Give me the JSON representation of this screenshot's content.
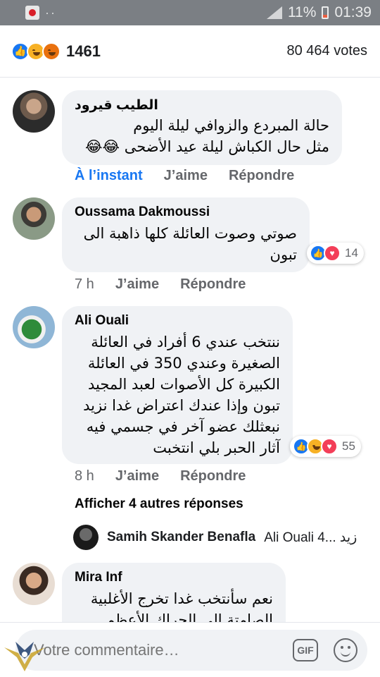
{
  "statusbar": {
    "battery": "11%",
    "time": "01:39"
  },
  "header": {
    "reaction_count": "1461",
    "votes": "80 464 votes"
  },
  "comments": [
    {
      "author": "الطيب قيرود",
      "lines": [
        "حالة المبردع والزوافي ليلة اليوم",
        "مثل حال الكباش ليلة عيد الأضحى 😂😂"
      ],
      "time": "À l’instant",
      "like": "J’aime",
      "reply": "Répondre"
    },
    {
      "author": "Oussama Dakmoussi",
      "lines": [
        "صوتي وصوت العائلة كلها ذاهبة الى",
        "تبون"
      ],
      "time": "7 h",
      "like": "J’aime",
      "reply": "Répondre",
      "reactions_count": "14"
    },
    {
      "author": "Ali Ouali",
      "lines": [
        "ننتخب عندي 6 أفراد في العائلة",
        "الصغيرة وعندي 350 في العائلة",
        "الكبيرة كل الأصوات لعبد المجيد",
        "تبون وإذا عندك اعتراض غدا نزيد",
        "نبعثلك عضو آخر في جسمي فيه",
        "آثار الحبر بلي انتخبت"
      ],
      "time": "8 h",
      "like": "J’aime",
      "reply": "Répondre",
      "reactions_count": "55"
    },
    {
      "author": "Mira Inf",
      "lines": [
        "نعم سأنتخب غدا تخرج الأغلبية",
        "الصامتة الى الحراك الأعظم زحوو"
      ]
    }
  ],
  "more_replies": "Afficher 4 autres réponses",
  "reply_preview": {
    "name": "Samih Skander Benafla",
    "text": "Ali Ouali 4... زيد"
  },
  "composer": {
    "placeholder": "Votre commentaire…",
    "gif_label": "GIF"
  },
  "colors": {
    "accent": "#1877f2",
    "bubble": "#f0f2f5",
    "muted": "#65676b"
  }
}
